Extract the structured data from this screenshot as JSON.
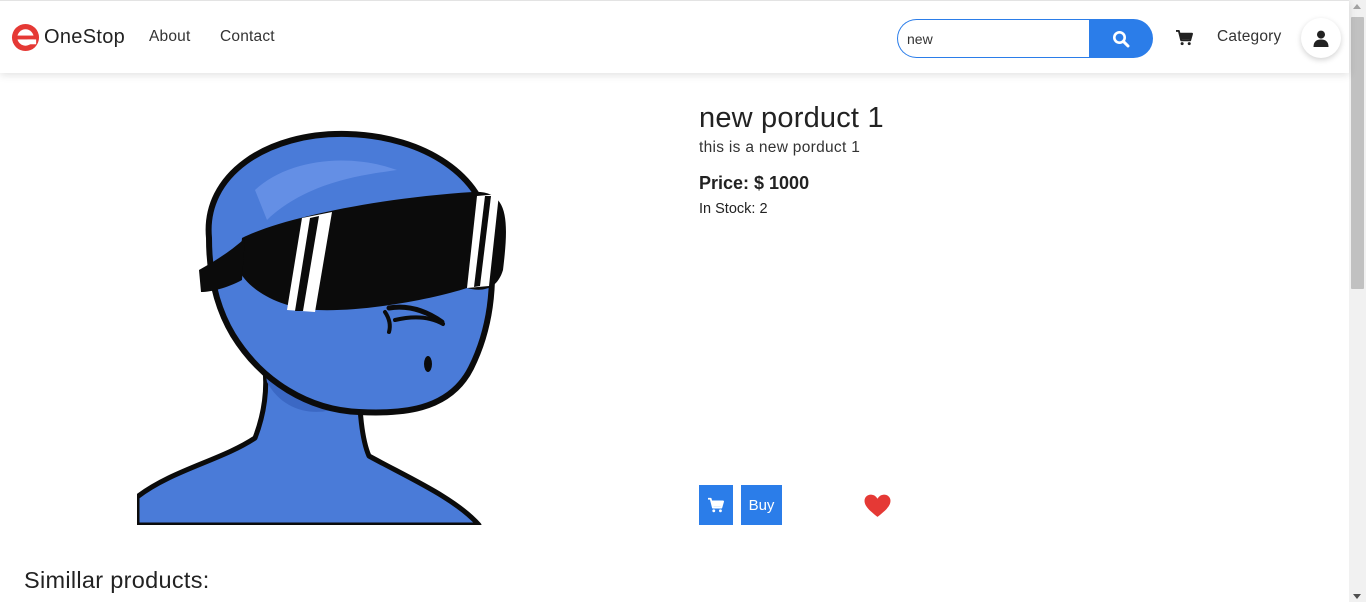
{
  "nav": {
    "brand": "OneStop",
    "links": {
      "about": "About",
      "contact": "Contact",
      "category": "Category"
    },
    "search": {
      "value": "new",
      "placeholder": ""
    },
    "icons": {
      "logo": "onestop-logo",
      "search": "search-icon",
      "cart": "cart-icon",
      "user": "user-icon"
    }
  },
  "product": {
    "title": "new porduct 1",
    "description": "this is a new porduct 1",
    "price_label": "Price: $ 1000",
    "stock_label": "In Stock: 2",
    "buy_label": "Buy",
    "image_name": "blue-character-sunglasses"
  },
  "similar": {
    "heading": "Simillar products:"
  },
  "colors": {
    "accent": "#2b7de9",
    "heart": "#e53935",
    "logo": "#e53935",
    "character": "#4a7bd8"
  }
}
